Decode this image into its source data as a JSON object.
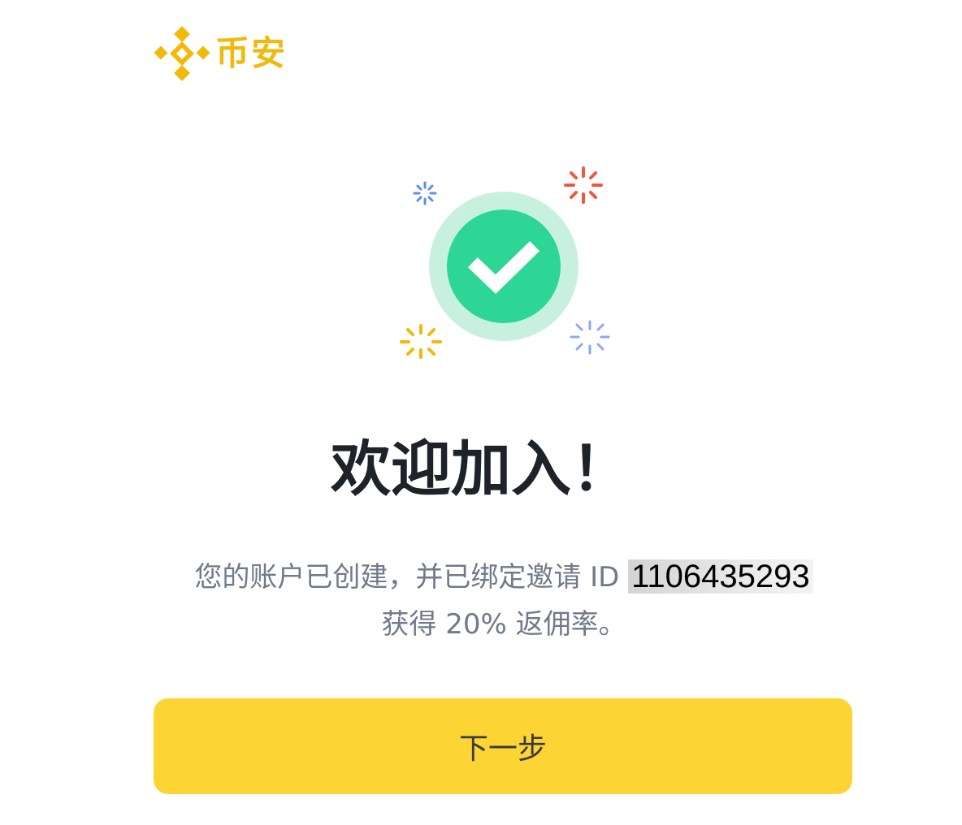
{
  "brand": {
    "logo_text": "币安",
    "icon": "binance-logo-icon",
    "color": "#f0b90b"
  },
  "illustration": {
    "icon": "check-circle-icon",
    "accent": "#2ed695",
    "halo": "#c8f0de"
  },
  "welcome": {
    "title": "欢迎加入！",
    "line1_prefix": "您的账户已创建，并已绑定邀请 ID ",
    "referral_id": "1106435293",
    "line2": "获得 20% 返佣率。"
  },
  "actions": {
    "next_label": "下一步",
    "button_color": "#fcd535"
  }
}
